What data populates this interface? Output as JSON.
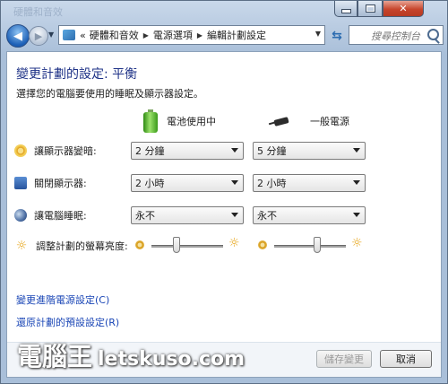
{
  "window": {
    "faded_title": "硬體和音效",
    "controls": {
      "minimize": "",
      "maximize": "",
      "close": "✕"
    }
  },
  "nav": {
    "back_icon": "◀",
    "forward_icon": "▶",
    "breadcrumbs": [
      "«",
      "硬體和音效",
      "電源選項",
      "編輯計劃設定"
    ],
    "search_placeholder": "搜尋控制台"
  },
  "page": {
    "title": "變更計劃的設定: 平衡",
    "subtitle": "選擇您的電腦要使用的睡眠及顯示器設定。",
    "columns": {
      "battery": "電池使用中",
      "plugged": "一般電源"
    }
  },
  "settings": [
    {
      "label": "讓顯示器變暗:",
      "icon": "dim-display-icon",
      "battery": "2 分鐘",
      "plugged": "5 分鐘"
    },
    {
      "label": "關閉顯示器:",
      "icon": "monitor-icon",
      "battery": "2 小時",
      "plugged": "2 小時"
    },
    {
      "label": "讓電腦睡眠:",
      "icon": "sleep-icon",
      "battery": "永不",
      "plugged": "永不"
    }
  ],
  "brightness": {
    "label": "調整計劃的螢幕亮度:",
    "battery_level": 0.35,
    "plugged_level": 0.6
  },
  "links": {
    "advanced": "變更進階電源設定(C)",
    "restore": "還原計劃的預設設定(R)"
  },
  "buttons": {
    "save": "儲存變更",
    "cancel": "取消"
  },
  "watermark": {
    "cn": "電腦王",
    "en": "letskuso.com"
  }
}
